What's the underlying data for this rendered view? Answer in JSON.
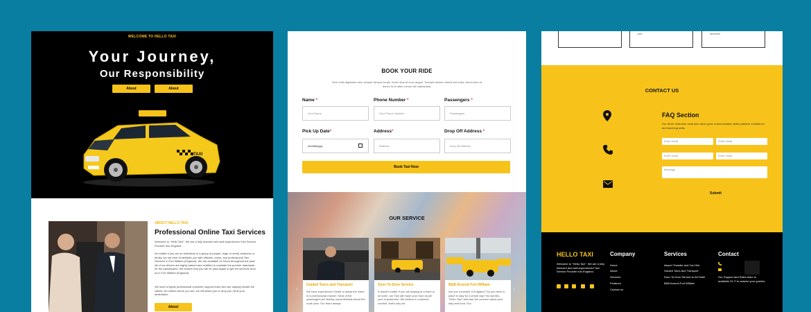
{
  "panel1": {
    "kicker": "WELCOME TO HELLO TAXI",
    "title_line1": "Your Journey,",
    "title_line2": "Our Responsibility",
    "buttons": [
      "About",
      "About"
    ],
    "about_kicker": "ABOUT HELLO TAXI",
    "about_title": "Professional Online Taxi Services",
    "para1": "Welcome to \"Hello Taxi\". We are a fully licensed and well-experienced Taxi Service Provider into England.",
    "para2": "No matter if you are an individual or a group of people, large or small, business or family, we are here to facilitate you with efficient, clean, and professional Taxi Services in Fort William (England). We are available 24 hours throughout the year. All of our drivers are highly trained and certified to maintain the premier standards for the passengers. We believe that you will be back again to get the services from us in Fort William (England).",
    "para3": "We have a highly professional customer support team who are staying beside the clients. No matter where you are, we will reach you to drop you off at your destination.",
    "about_button": "About"
  },
  "panel2": {
    "book_title": "BOOK YOUR RIDE",
    "book_sub": "Sem nulla dignissim arcu semper tempus turpis. Amet risus id nunc augue. Suscipit dictum mauris sed nulla. Amet enim et donec id ut diam cursus elit malesuada.",
    "fields": [
      {
        "label": "Name",
        "placeholder": "Your Name"
      },
      {
        "label": "Phone Number",
        "placeholder": "Your Phone Number"
      },
      {
        "label": "Passengers",
        "placeholder": "Passengers"
      },
      {
        "label": "Pick Up Date",
        "placeholder": "mm/dd/yyyy"
      },
      {
        "label": "Address",
        "placeholder": "Address"
      },
      {
        "label": "Drop Off Address",
        "placeholder": "Drop off Address"
      }
    ],
    "book_button": "Book Taxi Now",
    "service_title": "OUR SERVICE",
    "cards": [
      {
        "title": "Guided Tours and Transport",
        "desc": "We have experienced Guide to assist the client in a professional manner. Most of the passengers are feeling uncomfortable about the route plan. Our team always"
      },
      {
        "title": "Door-To-Door Service",
        "desc": "It doesn't matter if you are staying at a hotel or at home, our Taxi will reach your door as per your requirement. We believe in customer comfort, that's why we"
      },
      {
        "title": "B&B Around Fort William",
        "desc": "Are you a traveler in England? Do you need a place to stay for a whole day? No worries, \"Hello-Taxi\" also has the concern about your stay and food. Our"
      }
    ],
    "arrow_left": "‹",
    "arrow_right": "›"
  },
  "panel3": {
    "top_box_texts": [
      "you.",
      "services."
    ],
    "contact_title": "CONTACT US",
    "faq_title": "FAQ Section",
    "faq_sub": "Our driver instructor must also have good communication skills patience confidence and teaching skills.",
    "inputs": [
      "Enter email",
      "Enter email",
      "Enter email",
      "Enter email"
    ],
    "message_placeholder": "Message",
    "submit": "Submit",
    "footer": {
      "brand": "HELLO TAXI",
      "brand_desc": "Welcome to \"Hello-Taxi\". We are a fully licensed and well-experienced Taxi Service Provider into England.",
      "company_title": "Company",
      "company_links": [
        "Home",
        "About",
        "Services",
        "Features",
        "Contact us"
      ],
      "services_title": "Services",
      "services_links": [
        "Airport Transfer and Car Hire",
        "Guided Tours and Transport",
        "Door-To-Door Service to All Hotel",
        "B&B Around Fort William"
      ],
      "contact_title": "Contact",
      "contact_desc": "Our Support and Sales team is available 24 /7 to answer your queries"
    }
  },
  "colors": {
    "accent": "#f7c31b",
    "background": "#0a7ea0"
  }
}
